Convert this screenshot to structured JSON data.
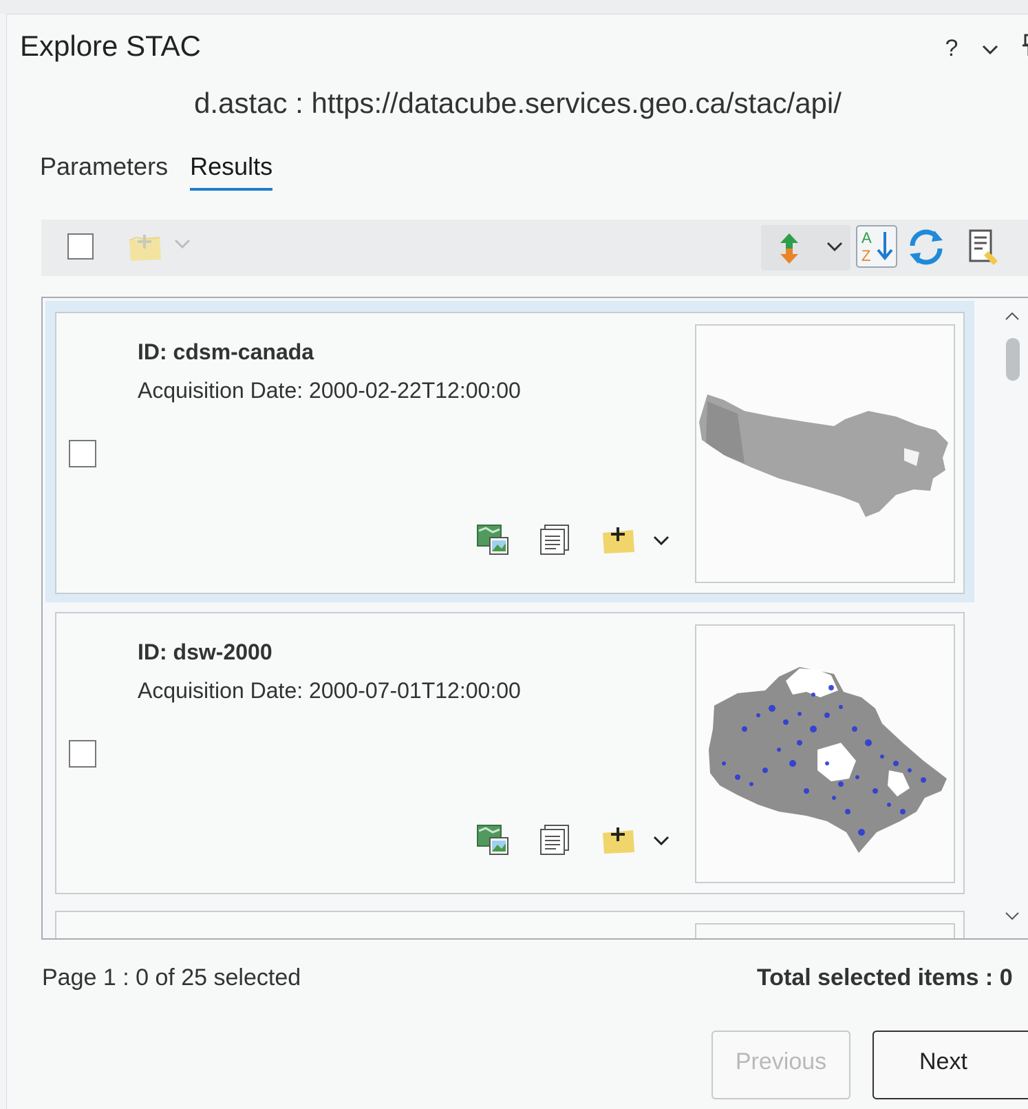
{
  "pane": {
    "title": "Explore STAC",
    "help_label": "?",
    "menu_chevron": "⌄",
    "pin_glyph": "📌",
    "source": "d.astac : https://datacube.services.geo.ca/stac/api/"
  },
  "tabs": [
    {
      "label": "Parameters",
      "active": false
    },
    {
      "label": "Results",
      "active": true
    }
  ],
  "toolbar": {
    "add_chevron": "⌄",
    "sort_chevron": "⌄"
  },
  "results": [
    {
      "id": "ID: cdsm-canada",
      "date": "Acquisition Date: 2000-02-22T12:00:00",
      "selected": true
    },
    {
      "id": "ID: dsw-2000",
      "date": "Acquisition Date: 2000-07-01T12:00:00",
      "selected": false
    }
  ],
  "footer": {
    "page_status": "Page 1 : 0 of 25 selected",
    "total_selected": "Total selected items : 0",
    "previous_label": "Previous",
    "next_label": "Next"
  },
  "colors": {
    "accent": "#1f7ccf",
    "selected_bg": "#dcebf6",
    "water_blue": "#2b3bd8"
  },
  "icons": [
    "help-icon",
    "chevron-down-icon",
    "pin-icon",
    "add-to-map-icon",
    "sort-icon",
    "sort-az-icon",
    "refresh-icon",
    "properties-icon",
    "preview-icon",
    "details-icon"
  ]
}
